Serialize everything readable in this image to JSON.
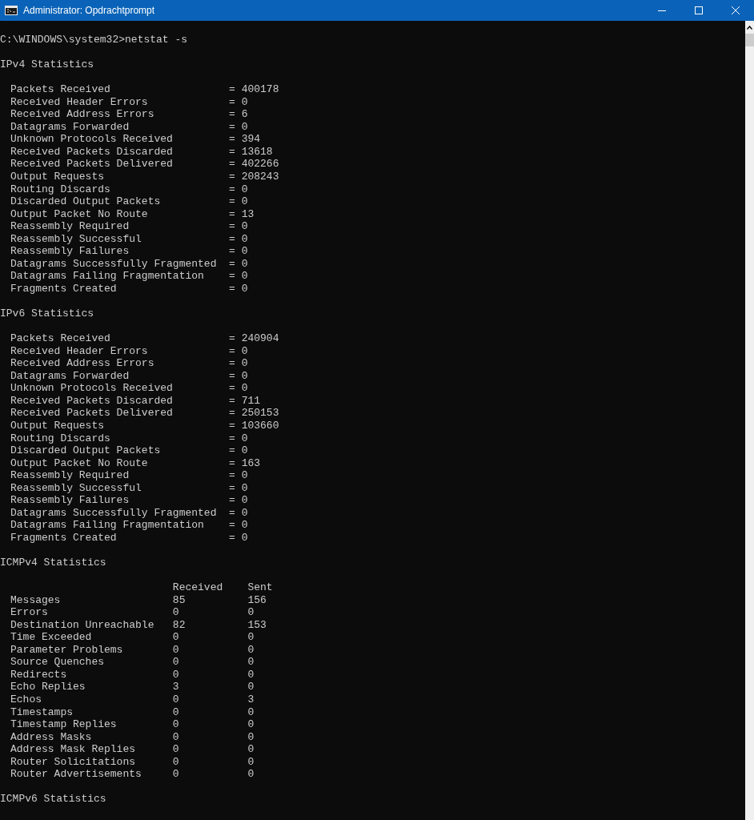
{
  "window": {
    "title": "Administrator: Opdrachtprompt"
  },
  "prompt": "C:\\WINDOWS\\system32>netstat -s",
  "ip_sections": [
    {
      "title": "IPv4 Statistics",
      "separator": "=",
      "rows": [
        {
          "label": "Packets Received",
          "value": "400178"
        },
        {
          "label": "Received Header Errors",
          "value": "0"
        },
        {
          "label": "Received Address Errors",
          "value": "6"
        },
        {
          "label": "Datagrams Forwarded",
          "value": "0"
        },
        {
          "label": "Unknown Protocols Received",
          "value": "394"
        },
        {
          "label": "Received Packets Discarded",
          "value": "13618"
        },
        {
          "label": "Received Packets Delivered",
          "value": "402266"
        },
        {
          "label": "Output Requests",
          "value": "208243"
        },
        {
          "label": "Routing Discards",
          "value": "0"
        },
        {
          "label": "Discarded Output Packets",
          "value": "0"
        },
        {
          "label": "Output Packet No Route",
          "value": "13"
        },
        {
          "label": "Reassembly Required",
          "value": "0"
        },
        {
          "label": "Reassembly Successful",
          "value": "0"
        },
        {
          "label": "Reassembly Failures",
          "value": "0"
        },
        {
          "label": "Datagrams Successfully Fragmented",
          "value": "0"
        },
        {
          "label": "Datagrams Failing Fragmentation",
          "value": "0"
        },
        {
          "label": "Fragments Created",
          "value": "0"
        }
      ]
    },
    {
      "title": "IPv6 Statistics",
      "separator": "=",
      "rows": [
        {
          "label": "Packets Received",
          "value": "240904"
        },
        {
          "label": "Received Header Errors",
          "value": "0"
        },
        {
          "label": "Received Address Errors",
          "value": "0"
        },
        {
          "label": "Datagrams Forwarded",
          "value": "0"
        },
        {
          "label": "Unknown Protocols Received",
          "value": "0"
        },
        {
          "label": "Received Packets Discarded",
          "value": "711"
        },
        {
          "label": "Received Packets Delivered",
          "value": "250153"
        },
        {
          "label": "Output Requests",
          "value": "103660"
        },
        {
          "label": "Routing Discards",
          "value": "0"
        },
        {
          "label": "Discarded Output Packets",
          "value": "0"
        },
        {
          "label": "Output Packet No Route",
          "value": "163"
        },
        {
          "label": "Reassembly Required",
          "value": "0"
        },
        {
          "label": "Reassembly Successful",
          "value": "0"
        },
        {
          "label": "Reassembly Failures",
          "value": "0"
        },
        {
          "label": "Datagrams Successfully Fragmented",
          "value": "0"
        },
        {
          "label": "Datagrams Failing Fragmentation",
          "value": "0"
        },
        {
          "label": "Fragments Created",
          "value": "0"
        }
      ]
    }
  ],
  "icmpv4": {
    "title": "ICMPv4 Statistics",
    "columns": [
      "Received",
      "Sent"
    ],
    "rows": [
      {
        "label": "Messages",
        "received": "85",
        "sent": "156"
      },
      {
        "label": "Errors",
        "received": "0",
        "sent": "0"
      },
      {
        "label": "Destination Unreachable",
        "received": "82",
        "sent": "153"
      },
      {
        "label": "Time Exceeded",
        "received": "0",
        "sent": "0"
      },
      {
        "label": "Parameter Problems",
        "received": "0",
        "sent": "0"
      },
      {
        "label": "Source Quenches",
        "received": "0",
        "sent": "0"
      },
      {
        "label": "Redirects",
        "received": "0",
        "sent": "0"
      },
      {
        "label": "Echo Replies",
        "received": "3",
        "sent": "0"
      },
      {
        "label": "Echos",
        "received": "0",
        "sent": "3"
      },
      {
        "label": "Timestamps",
        "received": "0",
        "sent": "0"
      },
      {
        "label": "Timestamp Replies",
        "received": "0",
        "sent": "0"
      },
      {
        "label": "Address Masks",
        "received": "0",
        "sent": "0"
      },
      {
        "label": "Address Mask Replies",
        "received": "0",
        "sent": "0"
      },
      {
        "label": "Router Solicitations",
        "received": "0",
        "sent": "0"
      },
      {
        "label": "Router Advertisements",
        "received": "0",
        "sent": "0"
      }
    ]
  },
  "icmpv6": {
    "title": "ICMPv6 Statistics"
  }
}
